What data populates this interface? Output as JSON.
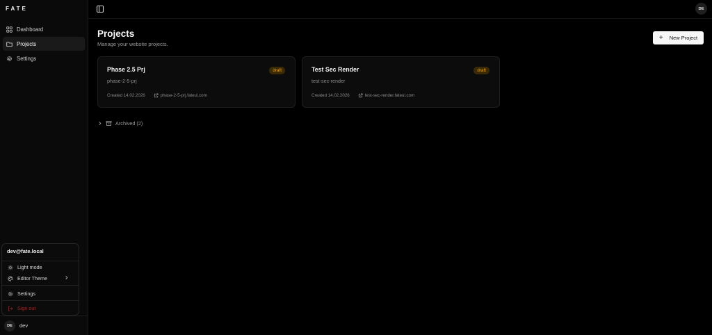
{
  "app": {
    "logo": "FATE"
  },
  "sidebar": {
    "items": [
      {
        "label": "Dashboard",
        "icon": "dashboard-icon",
        "active": false
      },
      {
        "label": "Projects",
        "icon": "folder-icon",
        "active": true
      },
      {
        "label": "Settings",
        "icon": "gear-icon",
        "active": false
      }
    ],
    "footer": {
      "initials": "DE",
      "name": "dev"
    }
  },
  "user_menu": {
    "email": "dev@fate.local",
    "items": [
      {
        "label": "Light mode",
        "icon": "sun-icon"
      },
      {
        "label": "Editor Theme",
        "icon": "palette-icon"
      },
      {
        "label": "Settings",
        "icon": "gear-icon"
      },
      {
        "label": "Sign out",
        "icon": "sign-out-icon",
        "color": "#8e2f2f"
      }
    ]
  },
  "topbar": {
    "initials": "DE"
  },
  "main": {
    "title": "Projects",
    "subtitle": "Manage your website projects.",
    "new_button": {
      "icon": "+",
      "label": "New Project"
    },
    "projects": [
      {
        "name": "Phase 2.5 Prj",
        "slug": "phase-2-5-prj",
        "status": "draft",
        "created": "Created 14.02.2026",
        "domain": "phase-2-5-prj.fateui.com"
      },
      {
        "name": "Test Sec Render",
        "slug": "test-sec-render",
        "status": "draft",
        "created": "Created 14.02.2026",
        "domain": "test-sec-render.fateui.com"
      }
    ],
    "archived_label": "Archived (2)"
  },
  "colors": {
    "accent": "#f7f7f7",
    "draft_badge_bg": "#3a2a05",
    "draft_badge_text": "#e8a326",
    "danger": "#8e2f2f"
  }
}
